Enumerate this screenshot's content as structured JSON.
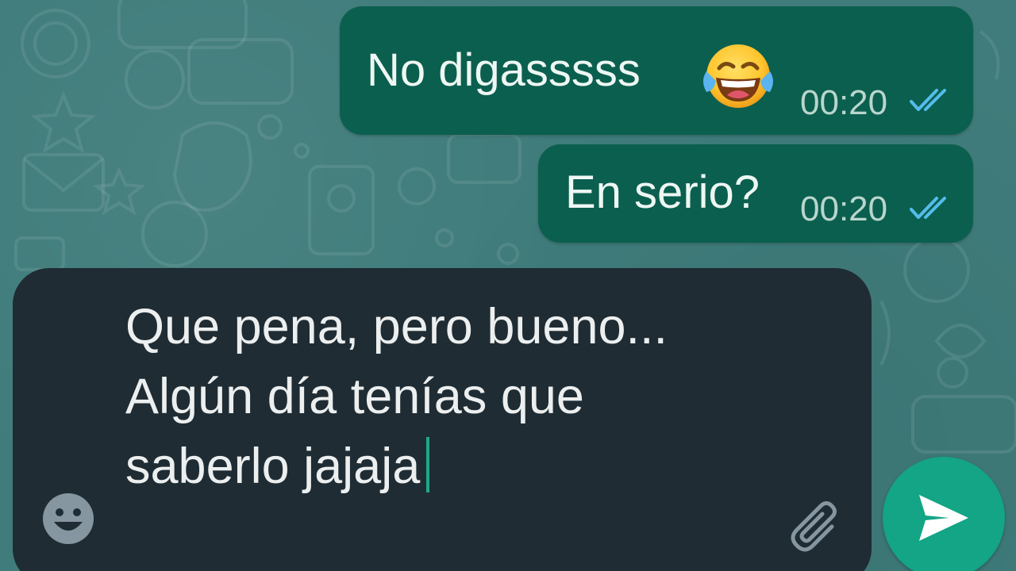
{
  "messages": [
    {
      "text": "No digasssss",
      "emoji": "face-with-tears-of-joy",
      "time": "00:20",
      "status": "read-double-check"
    },
    {
      "text": "En serio?",
      "time": "00:20",
      "status": "read-double-check"
    }
  ],
  "composer": {
    "text": "Que pena, pero bueno... Algún día tenías que saberlo jajaja",
    "emoji_icon": "smiley-icon",
    "attach_icon": "paperclip-icon",
    "send_icon": "send-arrow-icon"
  },
  "colors": {
    "wallpaper": "#3f7c7b",
    "outgoing_bubble": "#0b5f4f",
    "composer_background": "#1f2c33",
    "send_button": "#13a585",
    "read_ticks": "#53bdeb",
    "caret": "#1fa887"
  }
}
